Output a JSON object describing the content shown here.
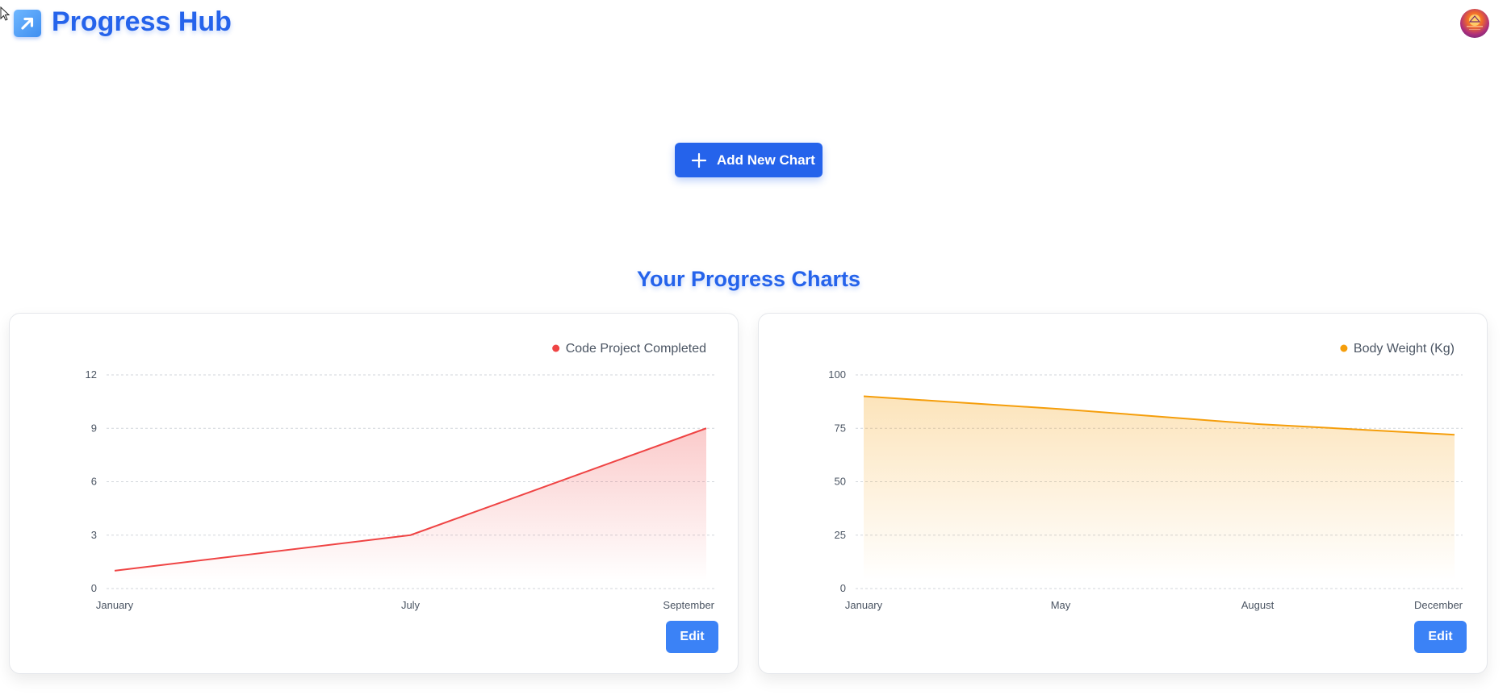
{
  "header": {
    "title": "Progress Hub",
    "logo_icon": "arrow-up-right-icon",
    "avatar_icon": "sunset-avatar-icon"
  },
  "actions": {
    "add_chart_label": "Add New Chart",
    "add_chart_icon": "plus-icon"
  },
  "section": {
    "title": "Your Progress Charts"
  },
  "colors": {
    "primary": "#2563eb",
    "button": "#3b82f6",
    "chart1": "#ef4444",
    "chart2": "#f59e0b"
  },
  "charts": [
    {
      "edit_label": "Edit"
    },
    {
      "edit_label": "Edit"
    }
  ],
  "chart_data": [
    {
      "type": "area",
      "series": [
        {
          "name": "Code Project Completed",
          "values": [
            1,
            3,
            9
          ]
        }
      ],
      "categories": [
        "January",
        "July",
        "September"
      ],
      "ylim": [
        0,
        12
      ],
      "yticks": [
        "0",
        "3",
        "6",
        "9",
        "12"
      ],
      "color": "#ef4444",
      "grid": true,
      "legend": "top-right"
    },
    {
      "type": "area",
      "series": [
        {
          "name": "Body Weight (Kg)",
          "values": [
            90,
            84,
            77,
            72
          ]
        }
      ],
      "categories": [
        "January",
        "May",
        "August",
        "December"
      ],
      "ylim": [
        0,
        100
      ],
      "yticks": [
        "0",
        "25",
        "50",
        "75",
        "100"
      ],
      "color": "#f59e0b",
      "grid": true,
      "legend": "top-right"
    }
  ]
}
